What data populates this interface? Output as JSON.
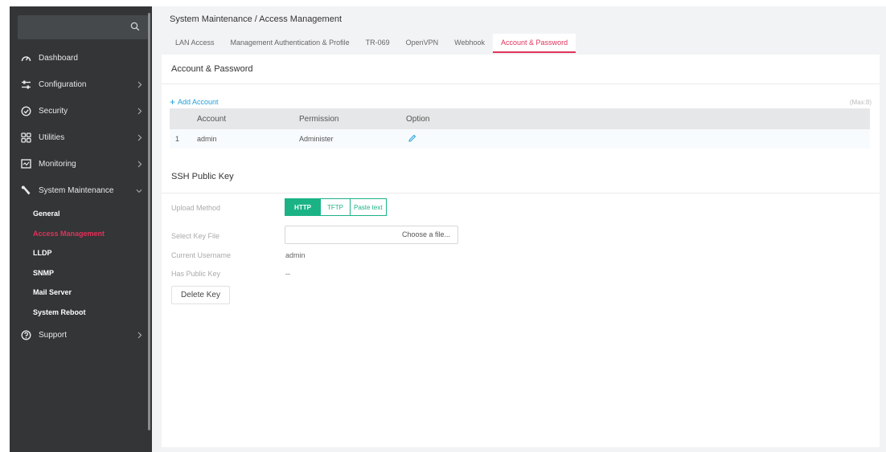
{
  "sidebar": {
    "search_placeholder": "",
    "items": [
      {
        "label": "Dashboard",
        "icon": "dashboard-icon"
      },
      {
        "label": "Configuration",
        "icon": "sliders-icon"
      },
      {
        "label": "Security",
        "icon": "shield-icon"
      },
      {
        "label": "Utilities",
        "icon": "grid-icon"
      },
      {
        "label": "Monitoring",
        "icon": "monitor-icon"
      },
      {
        "label": "System Maintenance",
        "icon": "wrench-icon"
      },
      {
        "label": "Support",
        "icon": "help-icon"
      }
    ],
    "sub_items": [
      {
        "label": "General"
      },
      {
        "label": "Access Management"
      },
      {
        "label": "LLDP"
      },
      {
        "label": "SNMP"
      },
      {
        "label": "Mail Server"
      },
      {
        "label": "System Reboot"
      }
    ]
  },
  "header": {
    "breadcrumb": "System Maintenance /  Access Management"
  },
  "tabs": [
    {
      "label": "LAN Access"
    },
    {
      "label": "Management Authentication & Profile"
    },
    {
      "label": "TR-069"
    },
    {
      "label": "OpenVPN"
    },
    {
      "label": "Webhook"
    },
    {
      "label": "Account & Password"
    }
  ],
  "account": {
    "title": "Account & Password",
    "add_label": "Add Account",
    "max_label": "(Max:8)",
    "columns": [
      "Account",
      "Permission",
      "Option"
    ],
    "rows": [
      {
        "index": "1",
        "account": "admin",
        "permission": "Administer"
      }
    ]
  },
  "ssh": {
    "title": "SSH Public Key",
    "upload_label": "Upload Method",
    "methods": [
      "HTTP",
      "TFTP",
      "Paste text"
    ],
    "select_label": "Select Key File",
    "choose_label": "Choose a file...",
    "user_label": "Current Username",
    "user_value": "admin",
    "has_key_label": "Has Public Key",
    "has_key_value": "--",
    "delete_label": "Delete Key"
  },
  "colors": {
    "accent": "#e0325a",
    "primary": "#1bb386",
    "link": "#1ea1d9",
    "sidebar_bg": "#333537"
  }
}
